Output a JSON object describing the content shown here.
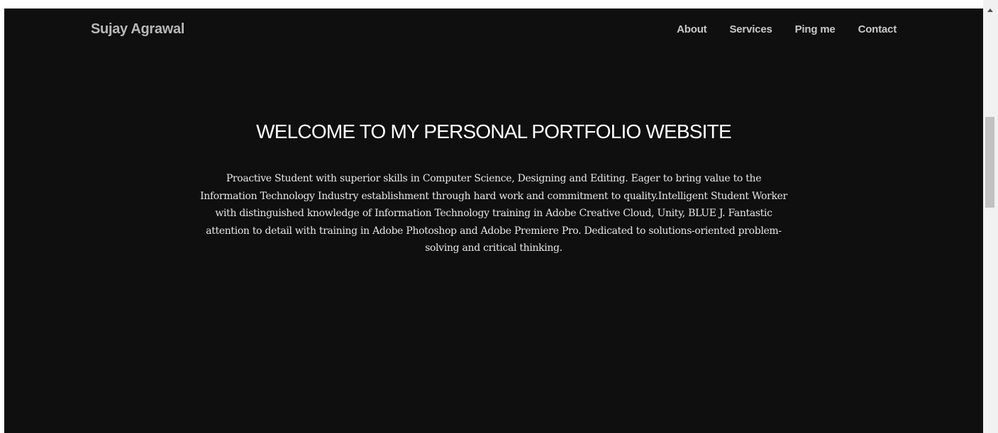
{
  "header": {
    "brand": "Sujay Agrawal",
    "nav": [
      {
        "label": "About"
      },
      {
        "label": "Services"
      },
      {
        "label": "Ping me"
      },
      {
        "label": "Contact"
      }
    ]
  },
  "hero": {
    "title": "WELCOME TO MY PERSONAL PORTFOLIO WEBSITE",
    "paragraph": "Proactive Student with superior skills in Computer Science, Designing and Editing. Eager to bring value to the Information Technology Industry establishment through hard work and commitment to quality.Intelligent Student Worker with distinguished knowledge of Information Technology training in Adobe Creative Cloud, Unity, BLUE J. Fantastic attention to detail with training in Adobe Photoshop and Adobe Premiere Pro. Dedicated to solutions-oriented problem-solving and critical thinking."
  },
  "colors": {
    "background": "#0f0f10",
    "brand_text": "#b8b8b8",
    "nav_text": "#c8c8c8",
    "title_text": "#ffffff",
    "body_text": "#e6e6e6"
  },
  "icons": {
    "scroll_up": "chevron-up-icon"
  }
}
